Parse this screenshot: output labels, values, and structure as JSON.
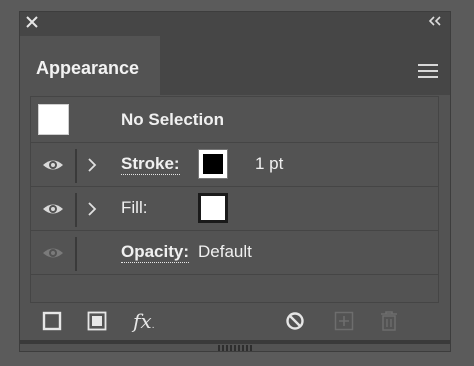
{
  "panel": {
    "tab_label": "Appearance"
  },
  "rows": {
    "selection": {
      "label": "No Selection"
    },
    "stroke": {
      "label": "Stroke:",
      "value": "1 pt"
    },
    "fill": {
      "label": "Fill:"
    },
    "opacity": {
      "label": "Opacity:",
      "value": "Default"
    }
  },
  "icons": {
    "close": "close-icon",
    "collapse": "double-chevron-left-icon",
    "menu": "hamburger-menu-icon",
    "visibility": "eye-icon",
    "expand": "chevron-right-icon",
    "add_stroke": "add-new-stroke-icon",
    "add_fill": "add-new-fill-icon",
    "fx": "add-effect-icon",
    "clear": "clear-appearance-icon",
    "duplicate": "duplicate-item-icon",
    "delete": "delete-item-icon"
  },
  "colors": {
    "panel_bg": "#535353",
    "titlebar_bg": "#464646",
    "text": "#f0f0f0"
  },
  "texts": {
    "fx_label": "fx"
  }
}
